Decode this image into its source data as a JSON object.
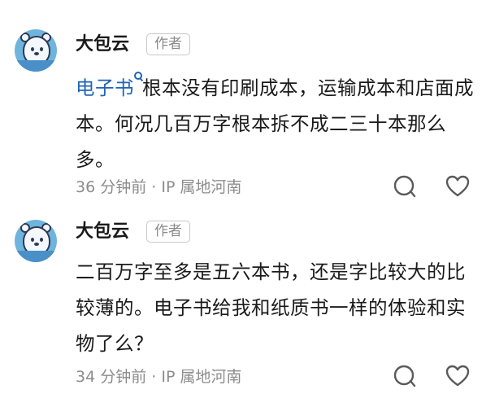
{
  "comments": [
    {
      "author": "大包云",
      "badge": "作者",
      "link_text": "电子书",
      "text": "根本没有印刷成本，运输成本和店面成本。何况几百万字根本拆不成二三十本那么多。",
      "meta": "36 分钟前 · IP 属地河南"
    },
    {
      "author": "大包云",
      "badge": "作者",
      "text": "二百万字至多是五六本书，还是字比较大的比较薄的。电子书给我和纸质书一样的体验和实物了么？",
      "meta": "34 分钟前 · IP 属地河南"
    }
  ],
  "icons": {
    "reply": "reply-bubble-icon",
    "like": "heart-icon",
    "link": "search-link-icon"
  },
  "colors": {
    "link": "#1e64b4",
    "meta": "#8c8c8c",
    "avatar_bg": "#6fb4dc"
  }
}
